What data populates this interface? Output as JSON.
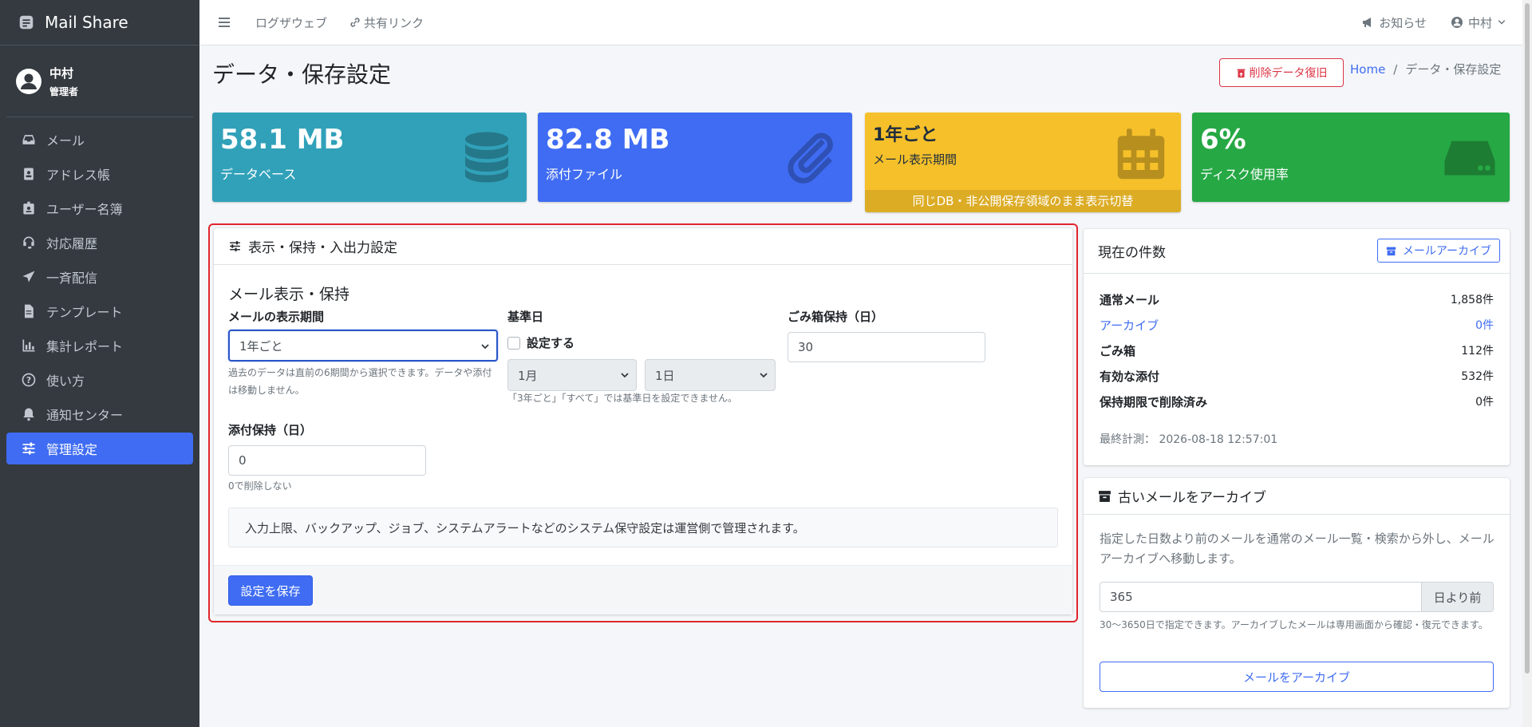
{
  "brand": {
    "name": "Mail Share"
  },
  "user": {
    "name": "中村",
    "role": "管理者"
  },
  "sidebar": {
    "items": [
      {
        "label": "メール",
        "icon": "inbox-icon"
      },
      {
        "label": "アドレス帳",
        "icon": "address-book-icon"
      },
      {
        "label": "ユーザー名簿",
        "icon": "id-badge-icon"
      },
      {
        "label": "対応履歴",
        "icon": "headset-icon"
      },
      {
        "label": "一斉配信",
        "icon": "paper-plane-icon"
      },
      {
        "label": "テンプレート",
        "icon": "file-icon"
      },
      {
        "label": "集計レポート",
        "icon": "bar-chart-icon"
      },
      {
        "label": "使い方",
        "icon": "question-icon"
      },
      {
        "label": "通知センター",
        "icon": "bell-icon"
      },
      {
        "label": "管理設定",
        "icon": "sliders-icon",
        "active": true
      }
    ]
  },
  "topbar": {
    "log_viewer": "ログザウェブ",
    "shared_link": "共有リンク",
    "notice": "お知らせ",
    "user_menu": "中村"
  },
  "page": {
    "title": "データ・保存設定",
    "restore_button": "削除データ復旧",
    "breadcrumb": {
      "home": "Home",
      "sep": "/",
      "current": "データ・保存設定"
    }
  },
  "stats": [
    {
      "value": "58.1 MB",
      "label": "データベース",
      "color": "#31a1b9"
    },
    {
      "value": "82.8 MB",
      "label": "添付ファイル",
      "color": "#3f6cf2"
    },
    {
      "value": "1年ごと",
      "label": "メール表示期間",
      "footer": "同じDB・非公開保存領域のまま表示切替",
      "color": "#f5c02a"
    },
    {
      "value": "6%",
      "label": "ディスク使用率",
      "color": "#26a845"
    }
  ],
  "settings": {
    "header": "表示・保持・入出力設定",
    "section_title": "メール表示・保持",
    "display_period": {
      "label": "メールの表示期間",
      "value": "1年ごと",
      "help": "過去のデータは直前の6期間から選択できます。データや添付は移動しません。"
    },
    "base_date": {
      "label": "基準日",
      "checkbox": "設定する",
      "month": "1月",
      "day": "1日",
      "help": "「3年ごと」「すべて」では基準日を設定できません。"
    },
    "trash_retention": {
      "label": "ごみ箱保持（日）",
      "value": "30"
    },
    "attach_retention": {
      "label": "添付保持（日）",
      "value": "0",
      "help": "0で削除しない"
    },
    "info": "入力上限、バックアップ、ジョブ、システムアラートなどのシステム保守設定は運営側で管理されます。",
    "save_button": "設定を保存"
  },
  "counts": {
    "header": "現在の件数",
    "archive_button": "メールアーカイブ",
    "rows": [
      {
        "label": "通常メール",
        "value": "1,858件"
      },
      {
        "label": "アーカイブ",
        "value": "0件"
      },
      {
        "label": "ごみ箱",
        "value": "112件"
      },
      {
        "label": "有効な添付",
        "value": "532件"
      },
      {
        "label": "保持期限で削除済み",
        "value": "0件"
      }
    ],
    "last_measured_label": "最終計測：",
    "last_measured_value": "2026-08-18 12:57:01"
  },
  "archive": {
    "header": "古いメールをアーカイブ",
    "description": "指定した日数より前のメールを通常のメール一覧・検索から外し、メールアーカイブへ移動します。",
    "days_value": "365",
    "days_suffix": "日より前",
    "help": "30〜3650日で指定できます。アーカイブしたメールは専用画面から確認・復元できます。",
    "button": "メールをアーカイブ"
  }
}
